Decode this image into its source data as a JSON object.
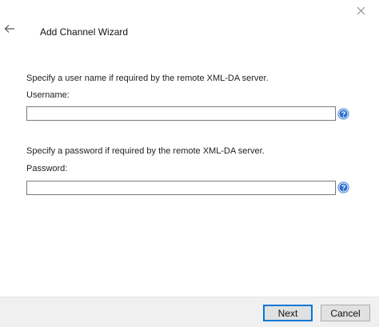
{
  "wizard": {
    "title": "Add Channel Wizard"
  },
  "username_section": {
    "prompt": "Specify a user name if required by the remote XML-DA server.",
    "label": "Username:",
    "value": ""
  },
  "password_section": {
    "prompt": "Specify a password if required by the remote XML-DA server.",
    "label": "Password:",
    "value": ""
  },
  "footer": {
    "next_label": "Next",
    "cancel_label": "Cancel"
  },
  "icons": {
    "close": "close-icon",
    "back": "back-arrow-icon",
    "help": "help-icon"
  },
  "colors": {
    "accent": "#0078d7",
    "help_blue": "#2a6fce"
  }
}
